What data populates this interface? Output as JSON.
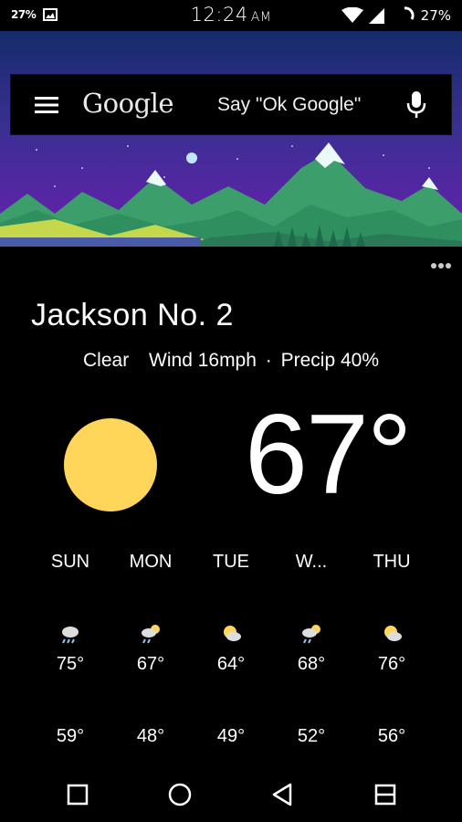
{
  "status_bar": {
    "battery_small": "27%",
    "time": "12:24",
    "ampm": "AM",
    "battery_pct": "27%",
    "icons": [
      "image-icon",
      "wifi-icon",
      "signal-icon",
      "battery-charging-icon"
    ]
  },
  "search": {
    "logo": "Google",
    "hint": "Say \"Ok Google\"",
    "icons": [
      "menu-icon",
      "mic-icon"
    ]
  },
  "weather": {
    "location": "Jackson No. 2",
    "condition": "Clear",
    "wind": "Wind 16mph",
    "separator": "·",
    "precip": "Precip 40%",
    "current_temp": "67°",
    "current_icon": "sun-icon",
    "sun_color": "#ffd65a"
  },
  "forecast": [
    {
      "day": "SUN",
      "icon": "rain-cloud-icon",
      "hi": "75°",
      "lo": "59°"
    },
    {
      "day": "MON",
      "icon": "rain-cloud-sun-icon",
      "hi": "67°",
      "lo": "48°"
    },
    {
      "day": "TUE",
      "icon": "partly-cloudy-icon",
      "hi": "64°",
      "lo": "49°"
    },
    {
      "day": "W...",
      "icon": "rain-cloud-sun-icon",
      "hi": "68°",
      "lo": "52°"
    },
    {
      "day": "THU",
      "icon": "partly-cloudy-icon",
      "hi": "76°",
      "lo": "56°"
    }
  ],
  "nav": [
    "recents-button",
    "home-button",
    "back-button",
    "split-screen-button"
  ]
}
